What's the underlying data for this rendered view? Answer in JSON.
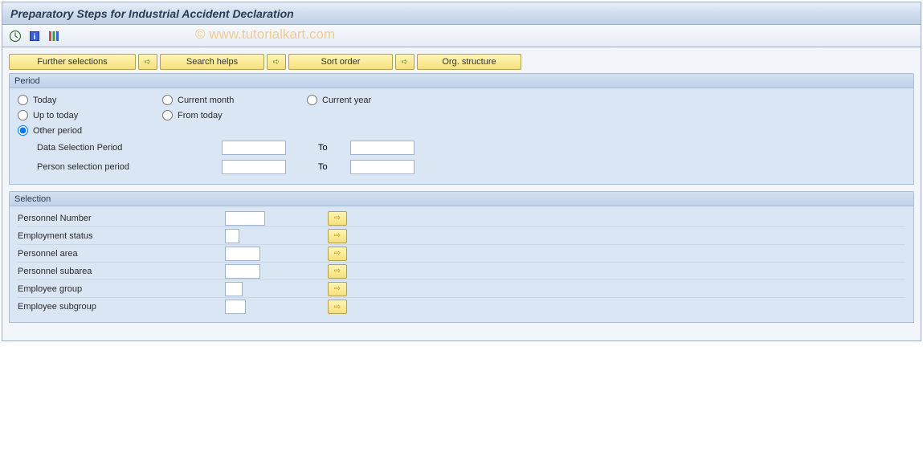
{
  "title": "Preparatory Steps for Industrial Accident Declaration",
  "watermark": "© www.tutorialkart.com",
  "toolbar": {
    "execute": "Execute",
    "info": "Information",
    "variant": "Variant"
  },
  "buttons": {
    "further_selections": "Further selections",
    "search_helps": "Search helps",
    "sort_order": "Sort order",
    "org_structure": "Org. structure"
  },
  "period": {
    "groupLabel": "Period",
    "today": "Today",
    "current_month": "Current month",
    "current_year": "Current year",
    "up_to_today": "Up to today",
    "from_today": "From today",
    "other_period": "Other period",
    "data_selection_period": "Data Selection Period",
    "person_selection_period": "Person selection period",
    "to": "To",
    "values": {
      "data_from": "",
      "data_to": "",
      "person_from": "",
      "person_to": ""
    },
    "selectedRadio": "other_period"
  },
  "selection": {
    "groupLabel": "Selection",
    "fields": {
      "personnel_number": {
        "label": "Personnel Number",
        "value": ""
      },
      "employment_status": {
        "label": "Employment status",
        "value": ""
      },
      "personnel_area": {
        "label": "Personnel area",
        "value": ""
      },
      "personnel_subarea": {
        "label": "Personnel subarea",
        "value": ""
      },
      "employee_group": {
        "label": "Employee group",
        "value": ""
      },
      "employee_subgroup": {
        "label": "Employee subgroup",
        "value": ""
      }
    }
  }
}
